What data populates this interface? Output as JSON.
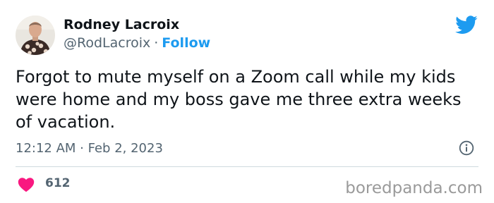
{
  "author": {
    "name": "Rodney Lacroix",
    "handle": "@RodLacroix",
    "separator": "·",
    "follow_label": "Follow",
    "avatar_icon": "profile-photo"
  },
  "tweet": {
    "text": "Forgot to mute myself on a Zoom call while my kids were home and my boss gave me three extra weeks of vacation.",
    "timestamp": "12:12 AM · Feb 2, 2023",
    "like_count": "612"
  },
  "icons": {
    "brand": "twitter-bird-icon",
    "info": "info-icon",
    "like": "heart-icon"
  },
  "colors": {
    "accent": "#1d9bf0",
    "like": "#f91880",
    "text": "#0f1419",
    "muted": "#536471",
    "watermark": "#9a9a9a"
  },
  "watermark": "boredpanda.com"
}
